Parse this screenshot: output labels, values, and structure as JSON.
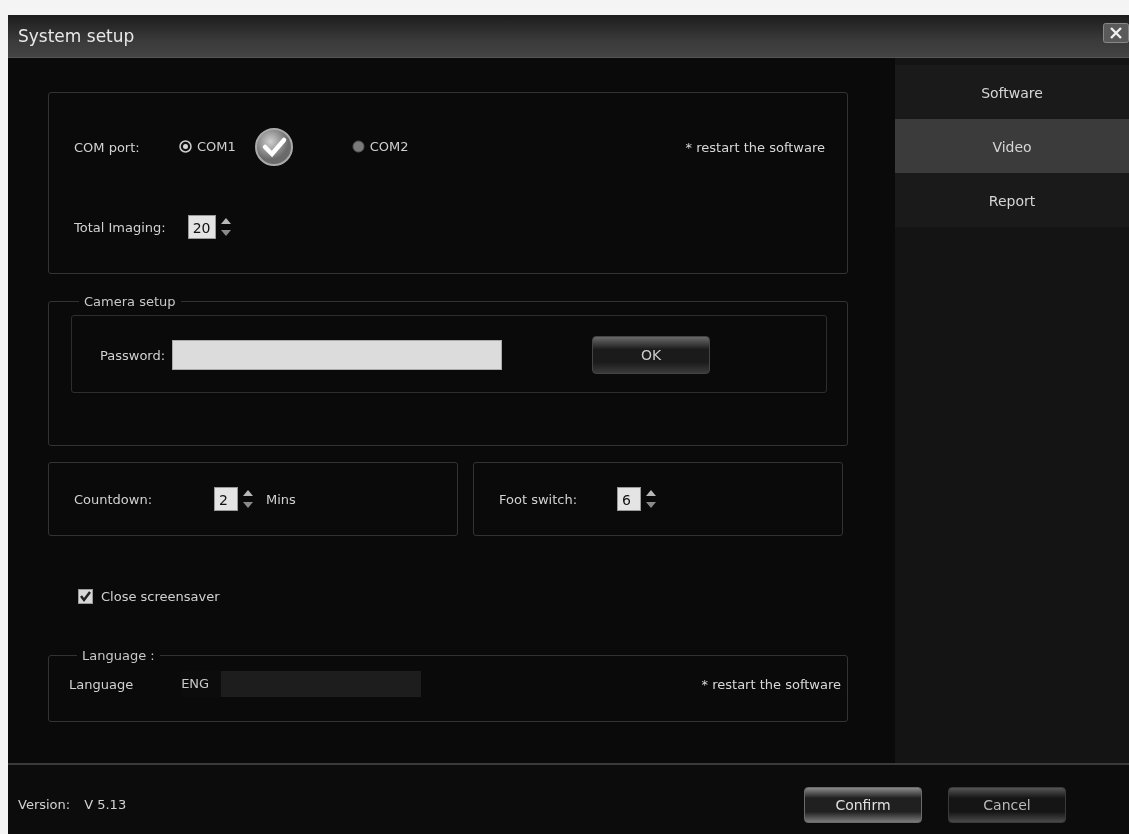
{
  "window": {
    "title": "System setup"
  },
  "tabs": [
    {
      "label": "Software",
      "selected": false
    },
    {
      "label": "Video",
      "selected": true
    },
    {
      "label": "Report",
      "selected": false
    }
  ],
  "com_port": {
    "label": "COM port:",
    "options": [
      {
        "label": "COM1",
        "selected": true
      },
      {
        "label": "COM2",
        "selected": false
      }
    ],
    "note": "* restart the software"
  },
  "total_imaging": {
    "label": "Total Imaging:",
    "value": "20"
  },
  "camera_setup": {
    "title": "Camera setup",
    "password_label": "Password:",
    "ok_button": "OK"
  },
  "countdown": {
    "label": "Countdown:",
    "value": "2",
    "unit": "Mins"
  },
  "foot_switch": {
    "label": "Foot switch:",
    "value": "6"
  },
  "close_screensaver": {
    "label": "Close screensaver",
    "checked": true
  },
  "language": {
    "title": "Language :",
    "label": "Language",
    "value": "ENG",
    "note": "* restart the software"
  },
  "footer": {
    "version_label": "Version:",
    "version": "V 5.13",
    "buttons": [
      {
        "label": "Confirm",
        "kind": "primary"
      },
      {
        "label": "Cancel",
        "kind": "secondary"
      }
    ]
  }
}
